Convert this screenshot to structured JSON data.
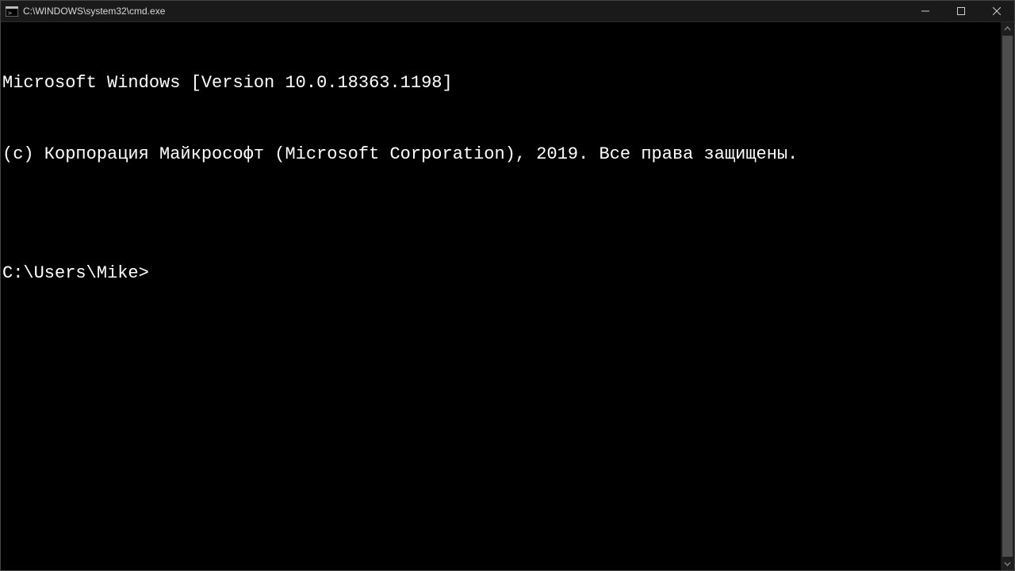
{
  "titlebar": {
    "title": "C:\\WINDOWS\\system32\\cmd.exe"
  },
  "terminal": {
    "lines": [
      "Microsoft Windows [Version 10.0.18363.1198]",
      "(c) Корпорация Майкрософт (Microsoft Corporation), 2019. Все права защищены.",
      "",
      "C:\\Users\\Mike>"
    ]
  }
}
